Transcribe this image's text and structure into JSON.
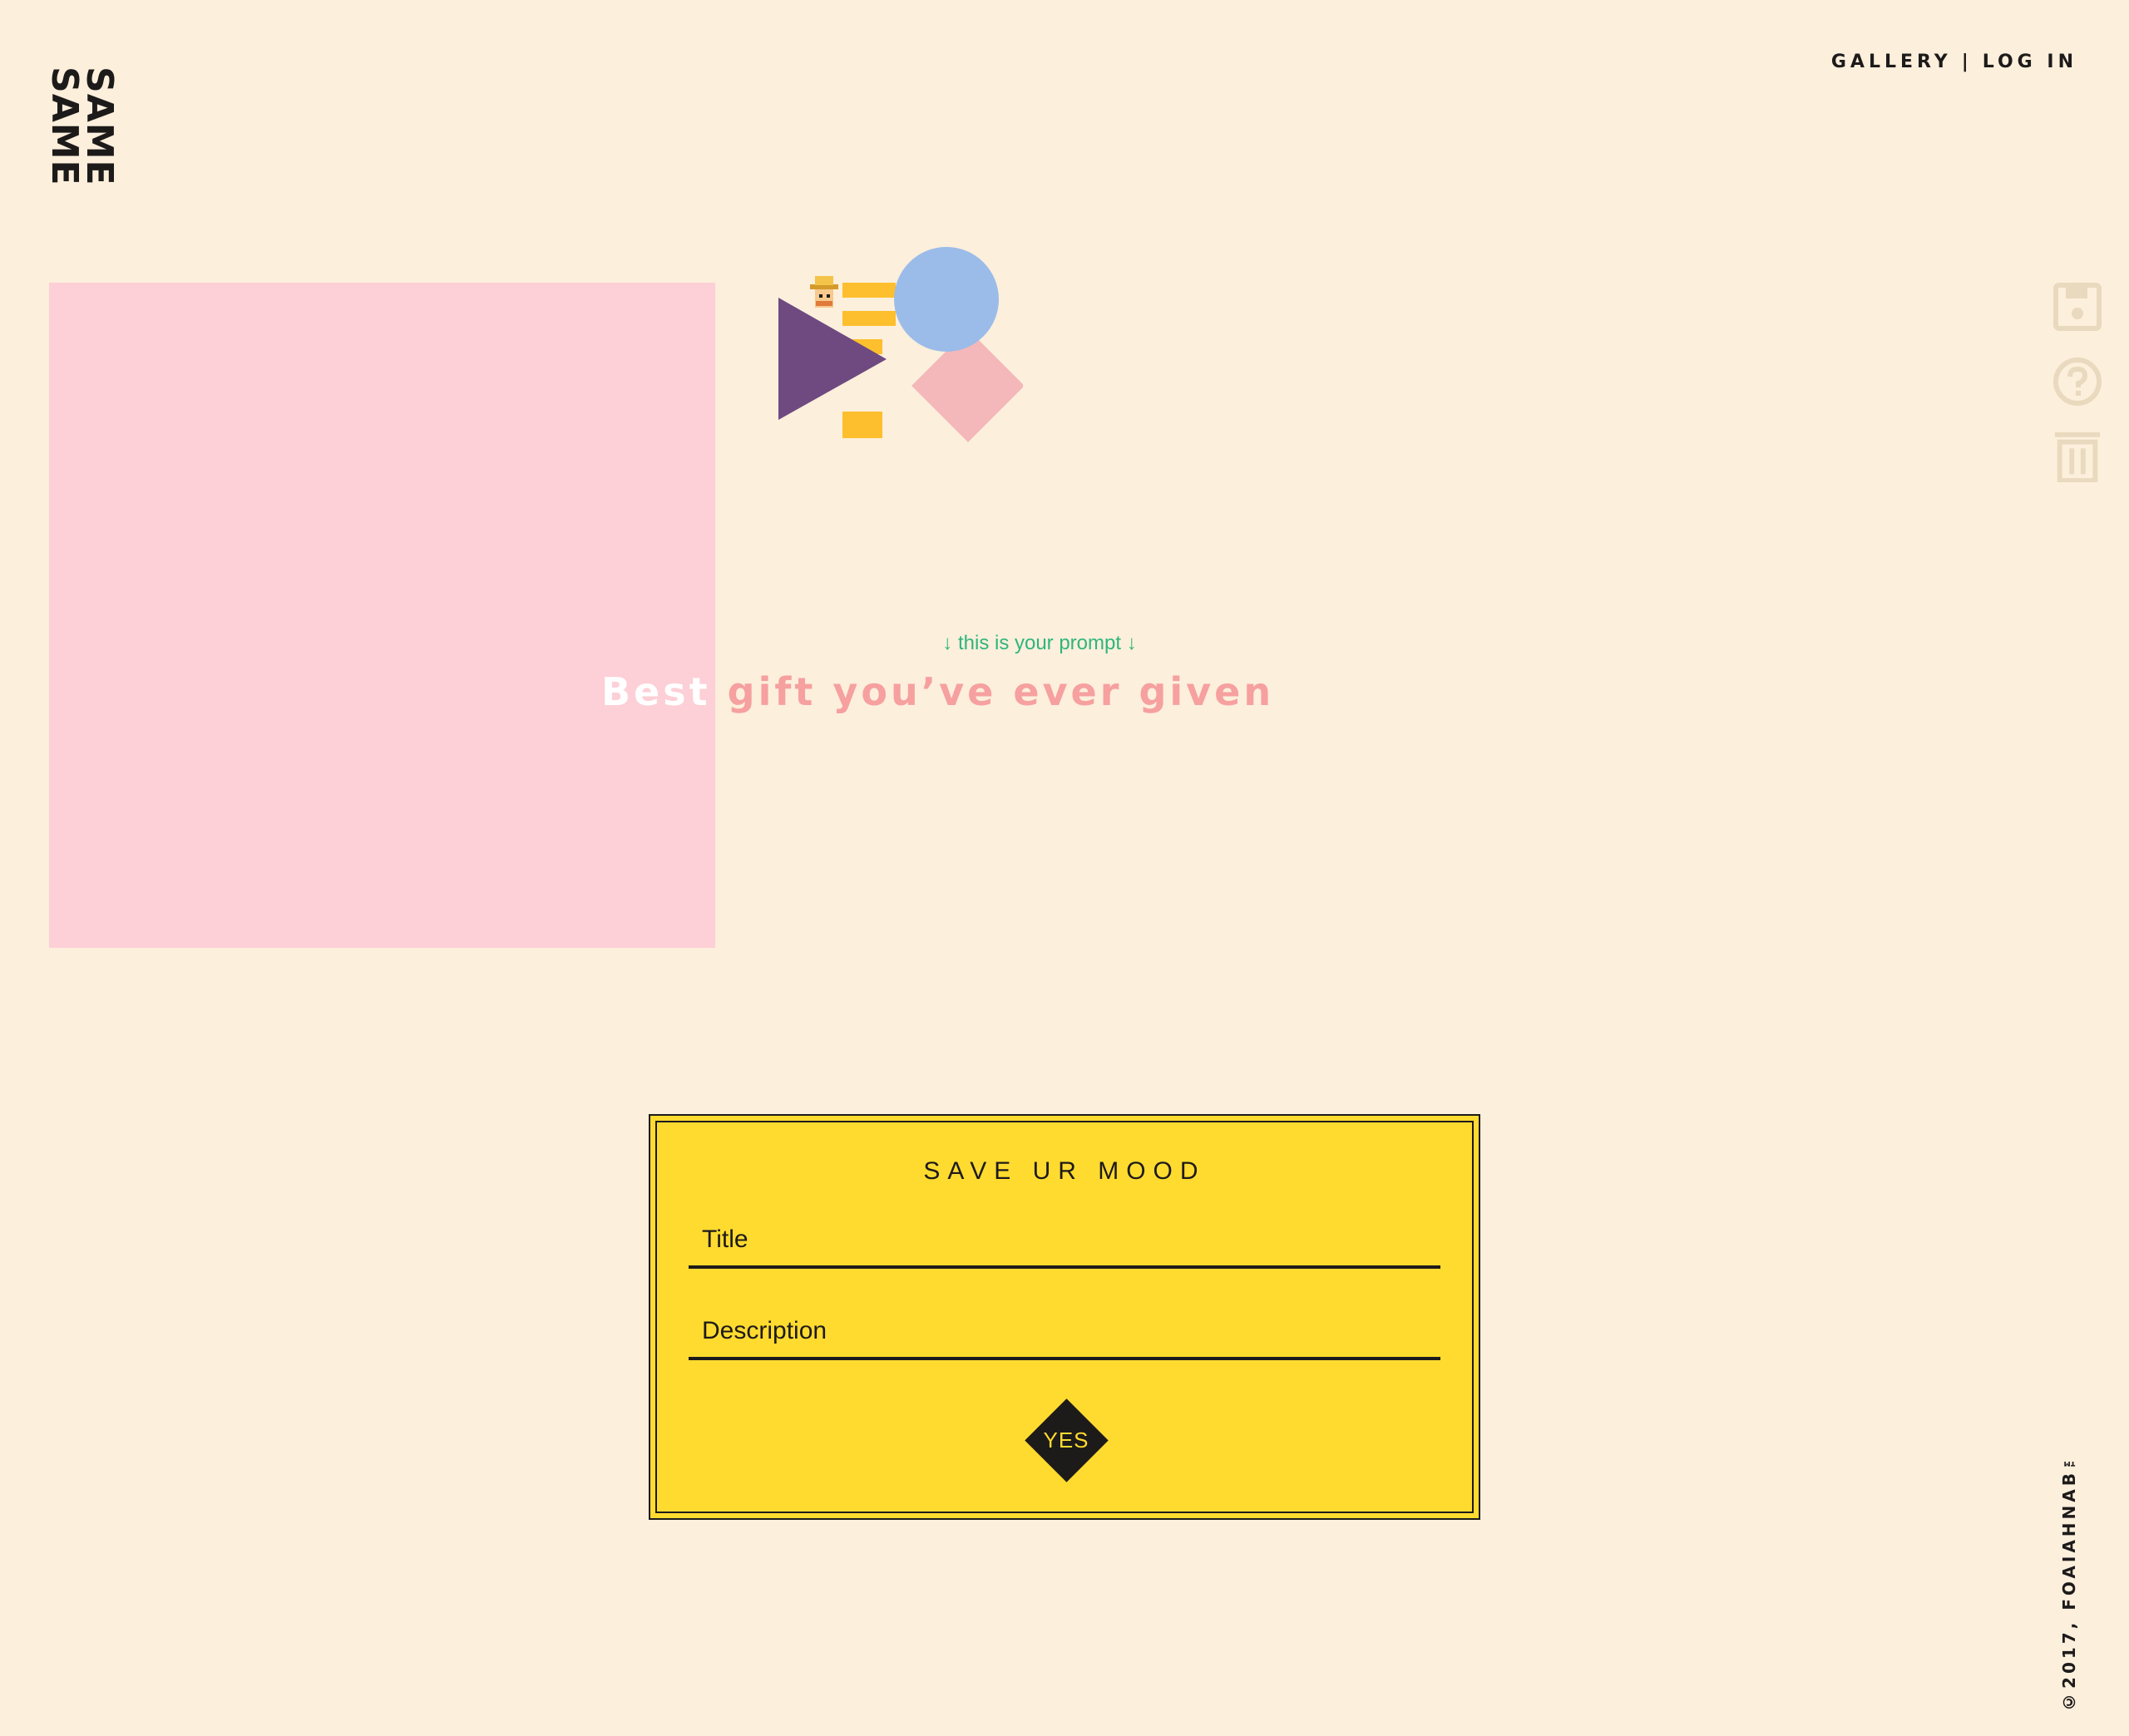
{
  "logo": {
    "line1": "SAME",
    "line2": "SAME"
  },
  "nav": {
    "gallery": "GALLERY",
    "separator": "|",
    "login": "LOG IN"
  },
  "canvas": {
    "fill_color": "#fdcfd6"
  },
  "shapes": {
    "triangle_color": "#6e4a80",
    "circle_color": "#9bbce9",
    "diamond_color": "#f4b7ba",
    "question_mark_color": "#fdbf2d"
  },
  "side_tools": [
    {
      "icon": "floppy-disk-icon"
    },
    {
      "icon": "question-circle-icon"
    },
    {
      "icon": "trash-icon"
    }
  ],
  "prompt": {
    "hint": "↓ this is your prompt ↓",
    "first_word": "Best",
    "rest": " gift you’ve ever given"
  },
  "save_form": {
    "heading": "SAVE UR MOOD",
    "title_placeholder": "Title",
    "description_placeholder": "Description",
    "submit_label": "YES"
  },
  "footer": {
    "copyright": "©2017, FOAIAHNAB™"
  },
  "colors": {
    "background": "#fcefdc",
    "accent_yellow": "#ffdb2f",
    "prompt_pink": "#f6a0a0",
    "hint_green": "#2fb57c",
    "tool_icon": "#e9d9be"
  }
}
